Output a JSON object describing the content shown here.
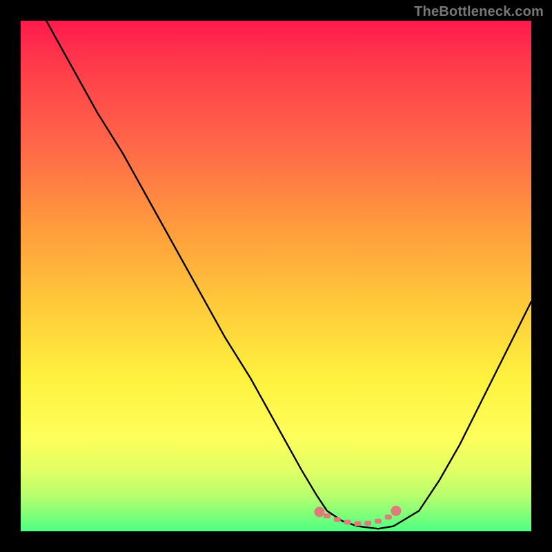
{
  "credit": "TheBottleneck.com",
  "chart_data": {
    "type": "line",
    "title": "",
    "xlabel": "",
    "ylabel": "",
    "x_range": [
      0,
      100
    ],
    "y_range": [
      0,
      100
    ],
    "series": [
      {
        "name": "bottleneck-curve",
        "x": [
          5,
          10,
          15,
          20,
          25,
          30,
          35,
          40,
          45,
          50,
          55,
          58,
          60,
          63,
          66,
          70,
          73,
          78,
          82,
          86,
          90,
          95,
          100
        ],
        "y": [
          100,
          91,
          82,
          74,
          65,
          56,
          47,
          38,
          30,
          21,
          12,
          7,
          4,
          2,
          1,
          0.5,
          1,
          4,
          10,
          17,
          25,
          35,
          45
        ]
      }
    ],
    "markers": {
      "name": "optimal-range",
      "color": "#e07b7b",
      "points_x": [
        58.5,
        60,
        62,
        64,
        66,
        68,
        70,
        72,
        73.5
      ],
      "points_y": [
        3.8,
        3.0,
        2.3,
        1.8,
        1.5,
        1.6,
        2.0,
        2.8,
        4.0
      ]
    },
    "gradient_stops": [
      {
        "pos": 0,
        "color": "#ff1a4d"
      },
      {
        "pos": 10,
        "color": "#ff3f4a"
      },
      {
        "pos": 25,
        "color": "#ff6948"
      },
      {
        "pos": 40,
        "color": "#ff9a3d"
      },
      {
        "pos": 55,
        "color": "#ffc83a"
      },
      {
        "pos": 70,
        "color": "#fff23e"
      },
      {
        "pos": 82,
        "color": "#fdff5c"
      },
      {
        "pos": 88,
        "color": "#e2ff64"
      },
      {
        "pos": 93,
        "color": "#b8ff6e"
      },
      {
        "pos": 100,
        "color": "#4dff82"
      }
    ]
  }
}
